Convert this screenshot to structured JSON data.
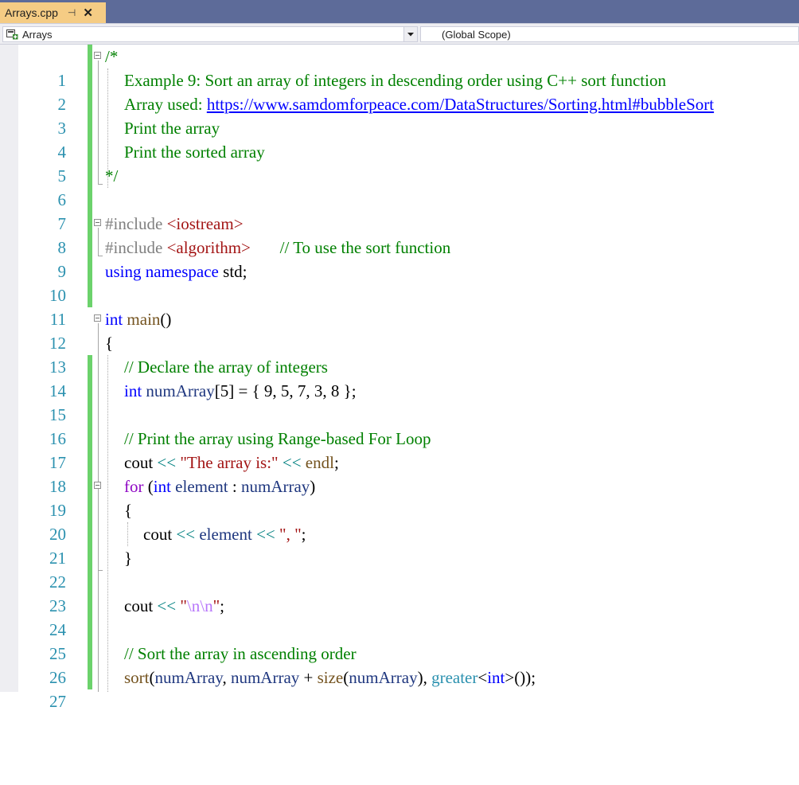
{
  "tab": {
    "title": "Arrays.cpp",
    "pin_glyph": "⊣",
    "close_glyph": "✕"
  },
  "navbar": {
    "project": "Arrays",
    "scope": "(Global Scope)"
  },
  "editor": {
    "lines": [
      "/*",
      "Example 9: Sort an array of integers in descending order using C++ sort function",
      "Array used: https://www.samdomforpeace.com/DataStructures/Sorting.html#bubbleSort",
      "Print the array",
      "Print the sorted array",
      "*/",
      "",
      "#include <iostream>",
      "#include <algorithm>       // To use the sort function",
      "using namespace std;",
      "",
      "int main()",
      "{",
      "// Declare the array of integers",
      "int numArray[5] = { 9, 5, 7, 3, 8 };",
      "",
      "// Print the array using Range-based For Loop",
      "cout << \"The array is:\" << endl;",
      "for (int element : numArray)",
      "{",
      "cout << element << \", \";",
      "}",
      "",
      "cout << \"\\n\\n\";",
      "",
      "// Sort the array in ascending order",
      "sort(numArray, numArray + size(numArray), greater<int>());"
    ]
  },
  "colors": {
    "tab_active": "#f5cc84",
    "tab_strip": "#5d6b99",
    "line_number": "#2b91af",
    "comment": "#008000",
    "keyword": "#0000ff",
    "string": "#a31515",
    "change_bar": "#6cd26c"
  },
  "icons": [
    "pin-icon",
    "close-icon",
    "project-icon",
    "dropdown-arrow-icon",
    "fold-toggle-icon"
  ]
}
